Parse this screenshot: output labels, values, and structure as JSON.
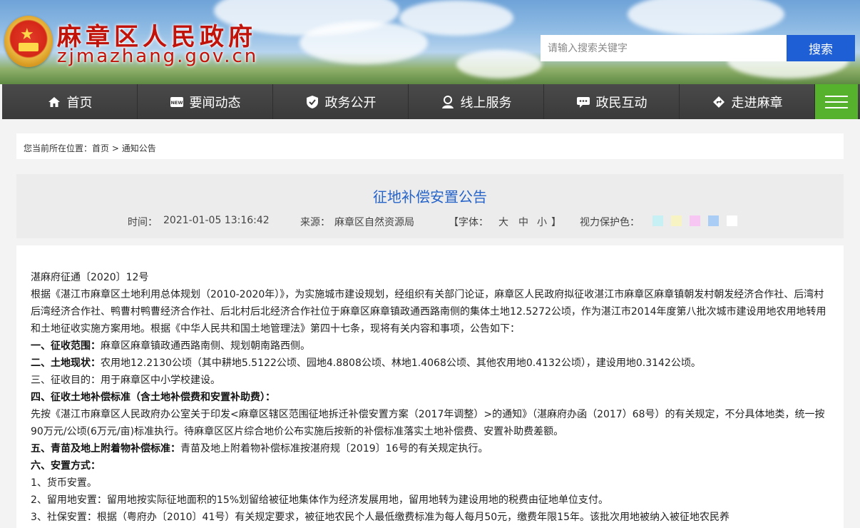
{
  "header": {
    "site_title": "麻章区人民政府",
    "site_domain": "zjmazhang.gov.cn",
    "search_placeholder": "请输入搜索关键字",
    "search_button": "搜索"
  },
  "nav": {
    "items": [
      {
        "label": "首页",
        "icon": "home-icon"
      },
      {
        "label": "要闻动态",
        "icon": "news-icon"
      },
      {
        "label": "政务公开",
        "icon": "shield-icon"
      },
      {
        "label": "线上服务",
        "icon": "user-icon"
      },
      {
        "label": "政民互动",
        "icon": "chat-icon"
      },
      {
        "label": "走进麻章",
        "icon": "direction-icon"
      }
    ],
    "menu_icon": "hamburger-menu-icon"
  },
  "breadcrumb": {
    "prefix": "您当前所在位置：",
    "home": "首页",
    "separator": " > ",
    "current": "通知公告"
  },
  "article": {
    "title": "征地补偿安置公告",
    "time_label": "时间：",
    "time": "2021-01-05 13:16:42",
    "source_label": "来源：",
    "source": "麻章区自然资源局",
    "font_label_open": "【字体：",
    "font_large": "大",
    "font_medium": "中",
    "font_small": "小",
    "font_label_close": "】",
    "eye_care_label": "视力保护色：",
    "eye_care_colors": [
      "#c7f0f5",
      "#f7f3c2",
      "#f7c6f2",
      "#a9cdf5",
      "#ffffff"
    ],
    "doc_number": "湛麻府征通〔2020〕12号",
    "intro": "根据《湛江市麻章区土地利用总体规划（2010-2020年）》，为实施城市建设规划，经组织有关部门论证，麻章区人民政府拟征收湛江市麻章区麻章镇朝发村朝发经济合作社、后湾村后湾经济合作社、鸭曹村鸭曹经济合作社、后北村后北经济合作社位于麻章区麻章镇政通西路南侧的集体土地12.5272公顷，作为湛江市2014年度第八批次城市建设用地农用地转用和土地征收实施方案用地。根据《中华人民共和国土地管理法》第四十七条，现将有关内容和事项，公告如下：",
    "s1_head": "一、征收范围：",
    "s1_text": "麻章区麻章镇政通西路南侧、规划朝南路西侧。",
    "s2_head": "二、土地现状：",
    "s2_text": "农用地12.2130公顷（其中耕地5.5122公顷、园地4.8808公顷、林地1.4068公顷、其他农用地0.4132公顷），建设用地0.3142公顷。",
    "s3_head": "三、征收目的",
    "s3_text": "：用于麻章区中小学校建设。",
    "s4_head": "四、征收土地补偿标准（含土地补偿费和安置补助费）：",
    "s4_text": "先按《湛江市麻章区人民政府办公室关于印发<麻章区辖区范围征地拆迁补偿安置方案（2017年调整）>的通知》（湛麻府办函（2017）68号）的有关规定，不分具体地类，统一按90万元/公顷(6万元/亩)标准执行。待麻章区区片综合地价公布实施后按新的补偿标准落实土地补偿费、安置补助费差额。",
    "s5_head": "五、青苗及地上附着物补偿标准：",
    "s5_text": "青苗及地上附着物补偿标准按湛府规〔2019〕16号的有关规定执行。",
    "s6_head": "六、安置方式：",
    "s6_1": "1、货币安置。",
    "s6_2": "2、留用地安置：留用地按实际征地面积的15%划留给被征地集体作为经济发展用地，留用地转为建设用地的税费由征地单位支付。",
    "s6_3": "3、社保安置：根据（粤府办〔2010〕41号）有关规定要求，被征地农民个人最低缴费标准为每人每月50元，缴费年限15年。该批次用地被纳入被征地农民养"
  }
}
